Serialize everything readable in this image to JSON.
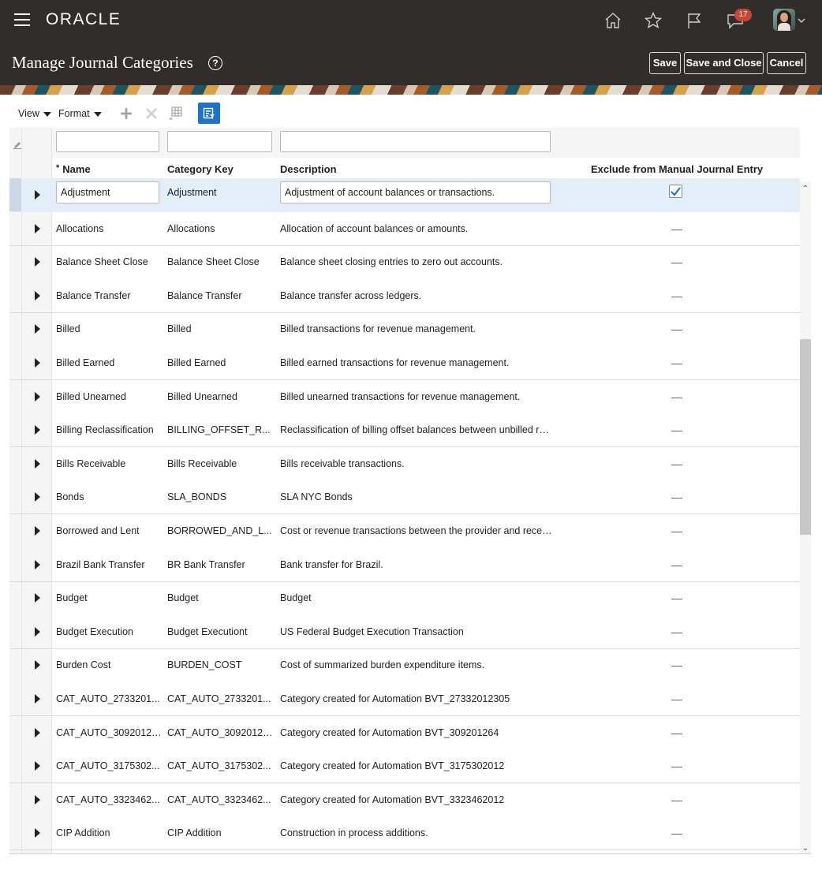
{
  "brand": {
    "logo": "ORACLE",
    "notifications_count": "17"
  },
  "header": {
    "title": "Manage Journal Categories",
    "help": "?",
    "save_label": "Save",
    "save_close_label": "Save and Close",
    "cancel_label": "Cancel"
  },
  "toolbar": {
    "view_label": "View",
    "format_label": "Format"
  },
  "columns": {
    "name": "Name",
    "required_mark": "*",
    "key": "Category Key",
    "description": "Description",
    "exclude": "Exclude from Manual Journal Entry"
  },
  "rows": [
    {
      "name": "Adjustment",
      "key": "Adjustment",
      "description": "Adjustment of account balances or transactions.",
      "exclude": true
    },
    {
      "name": "Allocations",
      "key": "Allocations",
      "description": "Allocation of account balances or amounts.",
      "exclude": false
    },
    {
      "name": "Balance Sheet Close",
      "key": "Balance Sheet Close",
      "description": "Balance sheet closing entries to zero out accounts.",
      "exclude": false
    },
    {
      "name": "Balance Transfer",
      "key": "Balance Transfer",
      "description": "Balance transfer across ledgers.",
      "exclude": false
    },
    {
      "name": "Billed",
      "key": "Billed",
      "description": "Billed transactions for revenue management.",
      "exclude": false
    },
    {
      "name": "Billed Earned",
      "key": "Billed Earned",
      "description": "Billed earned transactions for revenue management.",
      "exclude": false
    },
    {
      "name": "Billed Unearned",
      "key": "Billed Unearned",
      "description": "Billed unearned transactions for revenue management.",
      "exclude": false
    },
    {
      "name": "Billing Reclassification",
      "key": "BILLING_OFFSET_R...",
      "description": "Reclassification of billing offset balances between unbilled rec...",
      "exclude": false
    },
    {
      "name": "Bills Receivable",
      "key": "Bills Receivable",
      "description": "Bills receivable transactions.",
      "exclude": false
    },
    {
      "name": "Bonds",
      "key": "SLA_BONDS",
      "description": "SLA NYC Bonds",
      "exclude": false
    },
    {
      "name": "Borrowed and Lent",
      "key": "BORROWED_AND_L...",
      "description": "Cost or revenue transactions between the provider and receiv...",
      "exclude": false
    },
    {
      "name": "Brazil Bank Transfer",
      "key": "BR Bank Transfer",
      "description": "Bank transfer for Brazil.",
      "exclude": false
    },
    {
      "name": "Budget",
      "key": "Budget",
      "description": "Budget",
      "exclude": false
    },
    {
      "name": "Budget Execution",
      "key": "Budget Executiont",
      "description": "US Federal Budget Execution Transaction",
      "exclude": false
    },
    {
      "name": "Burden Cost",
      "key": "BURDEN_COST",
      "description": "Cost of summarized burden expenditure items.",
      "exclude": false
    },
    {
      "name": "CAT_AUTO_2733201...",
      "key": "CAT_AUTO_2733201...",
      "description": "Category created for Automation BVT_27332012305",
      "exclude": false
    },
    {
      "name": "CAT_AUTO_309201264",
      "key": "CAT_AUTO_309201264",
      "description": "Category created for Automation BVT_309201264",
      "exclude": false
    },
    {
      "name": "CAT_AUTO_3175302...",
      "key": "CAT_AUTO_3175302...",
      "description": "Category created for Automation BVT_3175302012",
      "exclude": false
    },
    {
      "name": "CAT_AUTO_3323462...",
      "key": "CAT_AUTO_3323462...",
      "description": "Category created for Automation BVT_3323462012",
      "exclude": false
    },
    {
      "name": "CIP Addition",
      "key": "CIP Addition",
      "description": "Construction in process additions.",
      "exclude": false
    }
  ]
}
